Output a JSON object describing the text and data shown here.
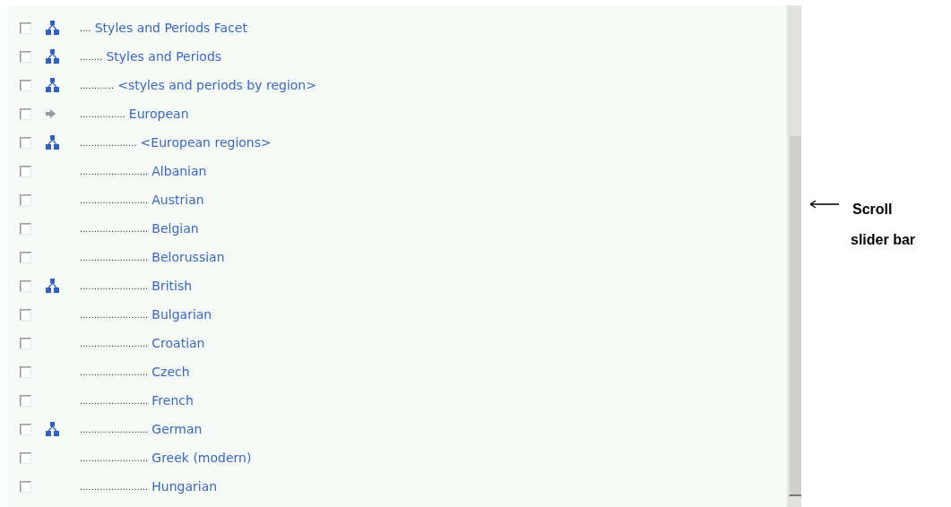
{
  "tree": [
    {
      "leader": "....",
      "label": "Styles and Periods Facet",
      "checked": false,
      "kind": "hierarchy",
      "children": [
        {
          "leader": "........",
          "label": "Styles and Periods",
          "checked": false,
          "kind": "hierarchy",
          "children": [
            {
              "leader": "............",
              "label": "<styles and periods by region>",
              "checked": false,
              "kind": "hierarchy",
              "children": [
                {
                  "leader": "................",
                  "label": "European",
                  "checked": false,
                  "kind": "arrow",
                  "children": [
                    {
                      "leader": "....................",
                      "label": "<European regions>",
                      "checked": false,
                      "kind": "hierarchy",
                      "children": [
                        {
                          "leader": "........................",
                          "label": "Albanian",
                          "checked": false
                        },
                        {
                          "leader": "........................",
                          "label": "Austrian",
                          "checked": false
                        },
                        {
                          "leader": "........................",
                          "label": "Belgian",
                          "checked": false
                        },
                        {
                          "leader": "........................",
                          "label": "Belorussian",
                          "checked": false
                        },
                        {
                          "leader": "........................",
                          "label": "British",
                          "checked": false,
                          "kind": "hierarchy"
                        },
                        {
                          "leader": "........................",
                          "label": "Bulgarian",
                          "checked": false
                        },
                        {
                          "leader": "........................",
                          "label": "Croatian",
                          "checked": false
                        },
                        {
                          "leader": "........................",
                          "label": "Czech",
                          "checked": false
                        },
                        {
                          "leader": "........................",
                          "label": "French",
                          "checked": false
                        },
                        {
                          "leader": "........................",
                          "label": "German",
                          "checked": false,
                          "kind": "hierarchy"
                        },
                        {
                          "leader": "........................",
                          "label": "Greek (modern)",
                          "checked": false
                        },
                        {
                          "leader": "........................",
                          "label": "Hungarian",
                          "checked": false
                        }
                      ]
                    }
                  ]
                }
              ]
            }
          ]
        }
      ]
    }
  ],
  "annotation": {
    "lines": [
      "Scroll",
      "slider bar"
    ]
  }
}
